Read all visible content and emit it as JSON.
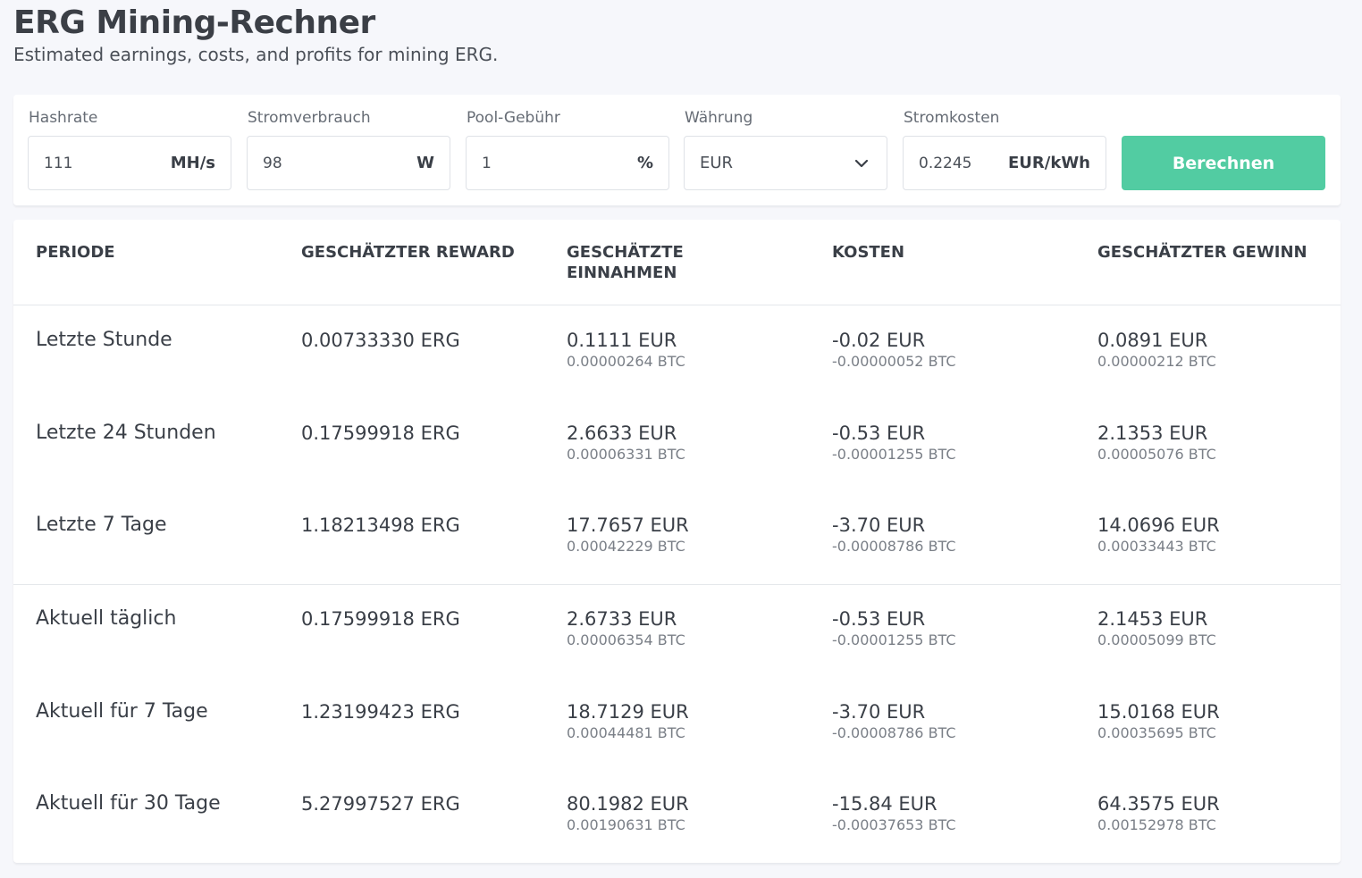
{
  "header": {
    "title": "ERG Mining-Rechner",
    "subtitle": "Estimated earnings, costs, and profits for mining ERG."
  },
  "calculator": {
    "hashrate": {
      "label": "Hashrate",
      "value": "111",
      "unit": "MH/s"
    },
    "power": {
      "label": "Stromverbrauch",
      "value": "98",
      "unit": "W"
    },
    "pool_fee": {
      "label": "Pool-Gebühr",
      "value": "1",
      "unit": "%"
    },
    "currency": {
      "label": "Währung",
      "value": "EUR",
      "icon": "chevron-down-icon"
    },
    "electricity_cost": {
      "label": "Stromkosten",
      "value": "0.2245",
      "unit": "EUR/kWh"
    },
    "calculate_label": "Berechnen",
    "accent_color": "#52cca2"
  },
  "table": {
    "headers": {
      "period": "PERIODE",
      "reward": "GESCHÄTZTER REWARD",
      "income": "GESCHÄTZTE EINNAHMEN",
      "costs": "KOSTEN",
      "profit": "GESCHÄTZTER GEWINN"
    },
    "rows": [
      {
        "period": "Letzte Stunde",
        "reward": "0.00733330 ERG",
        "income": "0.1111 EUR",
        "income_btc": "0.00000264 BTC",
        "costs": "-0.02 EUR",
        "costs_btc": "-0.00000052 BTC",
        "profit": "0.0891 EUR",
        "profit_btc": "0.00000212 BTC"
      },
      {
        "period": "Letzte 24 Stunden",
        "reward": "0.17599918 ERG",
        "income": "2.6633 EUR",
        "income_btc": "0.00006331 BTC",
        "costs": "-0.53 EUR",
        "costs_btc": "-0.00001255 BTC",
        "profit": "2.1353 EUR",
        "profit_btc": "0.00005076 BTC"
      },
      {
        "period": "Letzte 7 Tage",
        "reward": "1.18213498 ERG",
        "income": "17.7657 EUR",
        "income_btc": "0.00042229 BTC",
        "costs": "-3.70 EUR",
        "costs_btc": "-0.00008786 BTC",
        "profit": "14.0696 EUR",
        "profit_btc": "0.00033443 BTC"
      },
      {
        "period": "Aktuell täglich",
        "reward": "0.17599918 ERG",
        "income": "2.6733 EUR",
        "income_btc": "0.00006354 BTC",
        "costs": "-0.53 EUR",
        "costs_btc": "-0.00001255 BTC",
        "profit": "2.1453 EUR",
        "profit_btc": "0.00005099 BTC"
      },
      {
        "period": "Aktuell für 7 Tage",
        "reward": "1.23199423 ERG",
        "income": "18.7129 EUR",
        "income_btc": "0.00044481 BTC",
        "costs": "-3.70 EUR",
        "costs_btc": "-0.00008786 BTC",
        "profit": "15.0168 EUR",
        "profit_btc": "0.00035695 BTC"
      },
      {
        "period": "Aktuell für 30 Tage",
        "reward": "5.27997527 ERG",
        "income": "80.1982 EUR",
        "income_btc": "0.00190631 BTC",
        "costs": "-15.84 EUR",
        "costs_btc": "-0.00037653 BTC",
        "profit": "64.3575 EUR",
        "profit_btc": "0.00152978 BTC"
      }
    ]
  }
}
